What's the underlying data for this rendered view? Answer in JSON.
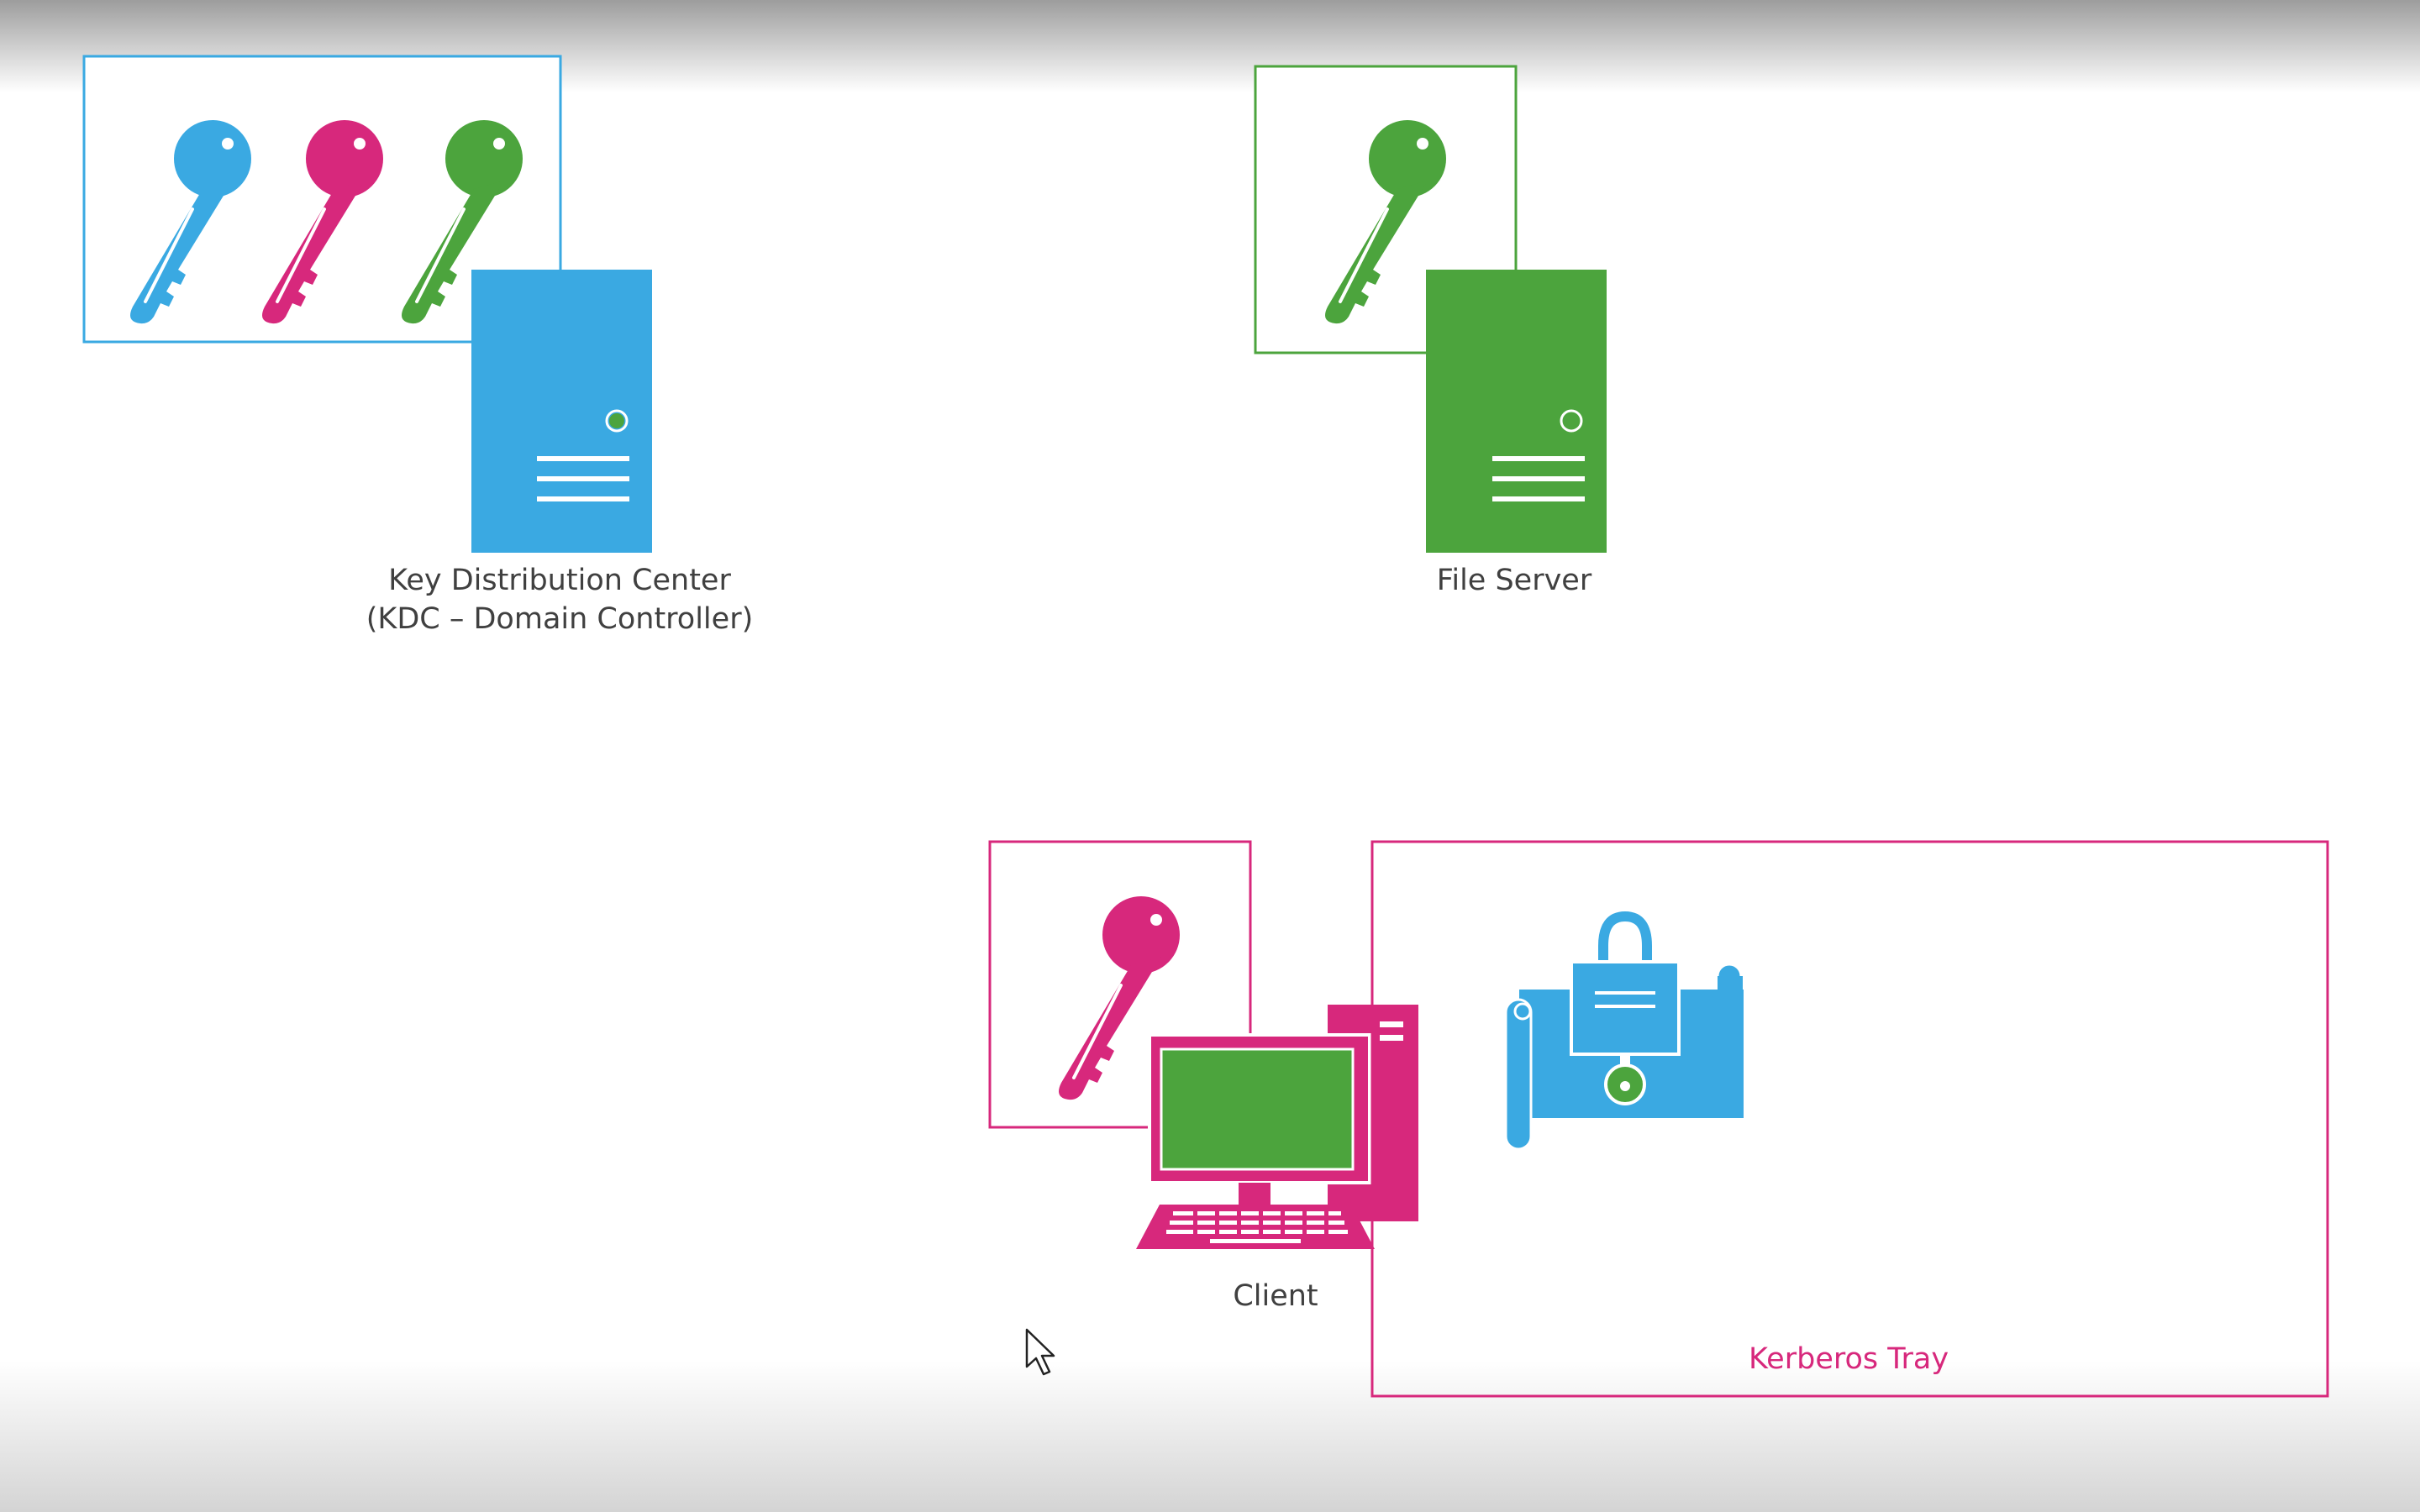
{
  "colors": {
    "blue": "#3aa9e2",
    "pink": "#d7287c",
    "green": "#4ca43d",
    "label_text": "#404040",
    "tray_label": "#d7287c"
  },
  "kdc": {
    "label_line1": "Key Distribution Center",
    "label_line2": "(KDC – Domain Controller)",
    "keys": [
      "blue-key-icon",
      "pink-key-icon",
      "green-key-icon"
    ],
    "server_icon": "server-icon"
  },
  "file_server": {
    "label": "File Server",
    "keys": [
      "green-key-icon"
    ],
    "server_icon": "server-icon"
  },
  "client": {
    "label": "Client",
    "keys": [
      "pink-key-icon"
    ],
    "computer_icon": "desktop-computer-icon"
  },
  "kerberos_tray": {
    "label": "Kerberos Tray",
    "contents": [
      "locked-ticket-icon"
    ]
  }
}
